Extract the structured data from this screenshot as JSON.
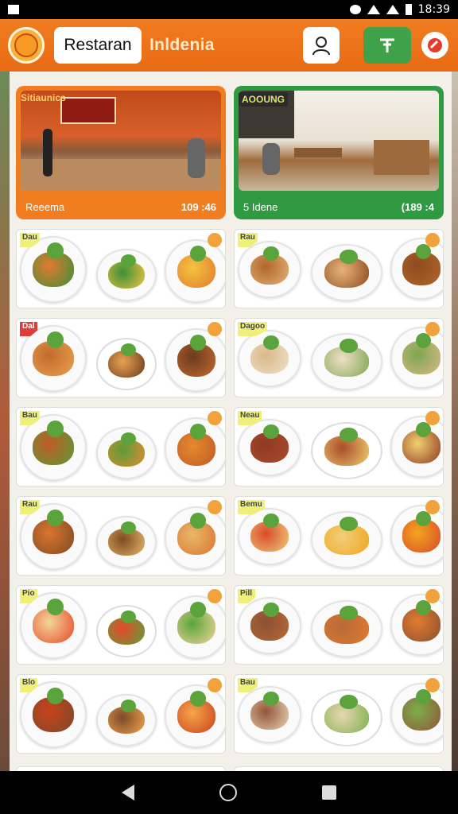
{
  "status_bar": {
    "time": "18:39"
  },
  "app_bar": {
    "search_label": "Restaran",
    "title": "Inldenia"
  },
  "heroes": [
    {
      "sign": "Sitiaunics",
      "label": "Reeema",
      "price": "109 :46"
    },
    {
      "sign": "AOOUNG",
      "label": "5 Idene",
      "price": "(189 :4"
    }
  ],
  "grid_cards": [
    {
      "badge": "Dau",
      "accent": "#f2a23a"
    },
    {
      "badge": "Rau",
      "accent": "#f2a23a"
    },
    {
      "badge": "Dal",
      "accent": "#f2a23a"
    },
    {
      "badge": "Dagoo",
      "accent": "#f2a23a"
    },
    {
      "badge": "Bau",
      "accent": "#f2a23a"
    },
    {
      "badge": "Neau",
      "accent": "#f2a23a"
    },
    {
      "badge": "Rau",
      "accent": "#f2a23a"
    },
    {
      "badge": "Bemu",
      "accent": "#f2a23a"
    },
    {
      "badge": "Pio",
      "accent": "#f2a23a"
    },
    {
      "badge": "Pill",
      "accent": "#f2a23a"
    },
    {
      "badge": "Blo",
      "accent": "#f2a23a"
    },
    {
      "badge": "Bau",
      "accent": "#f2a23a"
    }
  ],
  "colors": {
    "appbar": "#ee731a",
    "hero_green": "#2f9a41",
    "badge_yellow": "#eef07a"
  },
  "icons": {
    "logo": "emblem-icon",
    "user": "user-icon",
    "green_button": "pin-icon",
    "red_button": "tag-icon"
  }
}
